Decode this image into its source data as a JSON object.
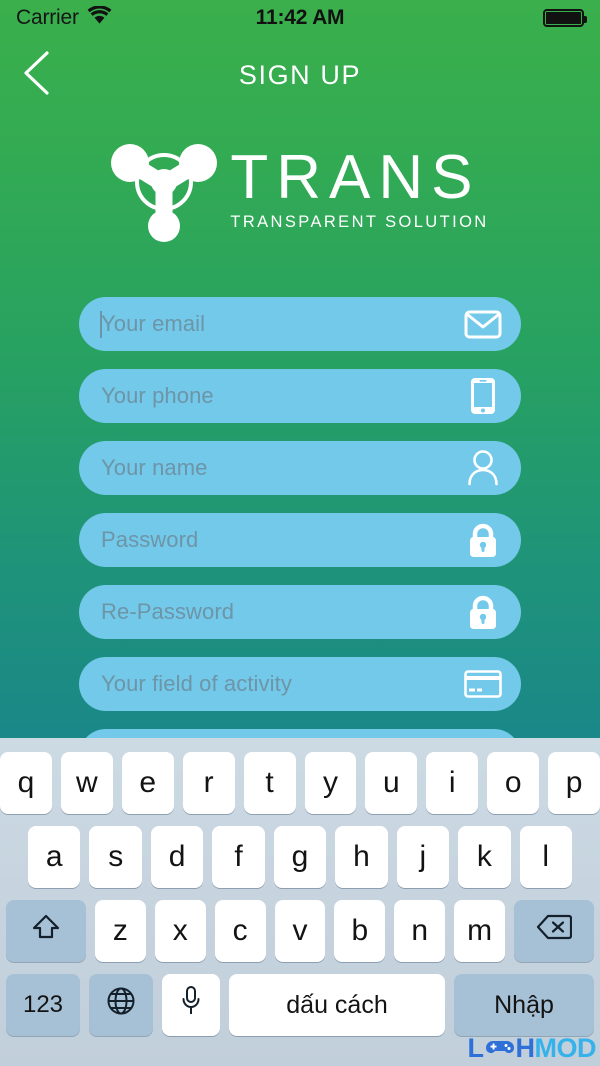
{
  "statusbar": {
    "carrier": "Carrier",
    "wifi_icon": "wifi-icon",
    "time": "11:42 AM",
    "battery_icon": "battery-full-icon"
  },
  "navbar": {
    "back_icon": "chevron-left-icon",
    "title": "SIGN UP"
  },
  "logo": {
    "mark_icon": "trans-triskelion-logo-icon",
    "word": "TRANS",
    "tagline": "TRANSPARENT SOLUTION"
  },
  "form": {
    "fields": [
      {
        "name": "email",
        "placeholder": "Your email",
        "icon": "envelope-icon",
        "focused": true
      },
      {
        "name": "phone",
        "placeholder": "Your phone",
        "icon": "mobile-phone-icon",
        "focused": false
      },
      {
        "name": "fullname",
        "placeholder": "Your name",
        "icon": "person-icon",
        "focused": false
      },
      {
        "name": "password",
        "placeholder": "Password",
        "icon": "lock-icon",
        "focused": false
      },
      {
        "name": "repassword",
        "placeholder": "Re-Password",
        "icon": "lock-icon",
        "focused": false
      },
      {
        "name": "activity",
        "placeholder": "Your field of activity",
        "icon": "credit-card-icon",
        "focused": false
      },
      {
        "name": "extra",
        "placeholder": "",
        "icon": "",
        "focused": false
      }
    ]
  },
  "keyboard": {
    "row1": [
      "q",
      "w",
      "e",
      "r",
      "t",
      "y",
      "u",
      "i",
      "o",
      "p"
    ],
    "row2": [
      "a",
      "s",
      "d",
      "f",
      "g",
      "h",
      "j",
      "k",
      "l"
    ],
    "row3": [
      "z",
      "x",
      "c",
      "v",
      "b",
      "n",
      "m"
    ],
    "shift_icon": "shift-arrow-icon",
    "backspace_icon": "backspace-icon",
    "numbers_label": "123",
    "globe_icon": "globe-icon",
    "mic_icon": "microphone-icon",
    "space_label": "dấu cách",
    "enter_label": "Nhập"
  },
  "watermark": {
    "text_left": "L",
    "text_mid": "H",
    "text_right": "MOD",
    "gamepad_icon": "gamepad-icon",
    "color": "#2f6fd8",
    "accent_color": "#36b2ea"
  },
  "colors": {
    "gradient_top": "#3aaf4b",
    "gradient_bottom": "#17798f",
    "field_bg": "#72c9e9",
    "placeholder": "#6e95a7",
    "keyboard_bg": "#ccdae4",
    "key_bg": "#ffffff",
    "modifier_key_bg": "#a6c0d5"
  }
}
